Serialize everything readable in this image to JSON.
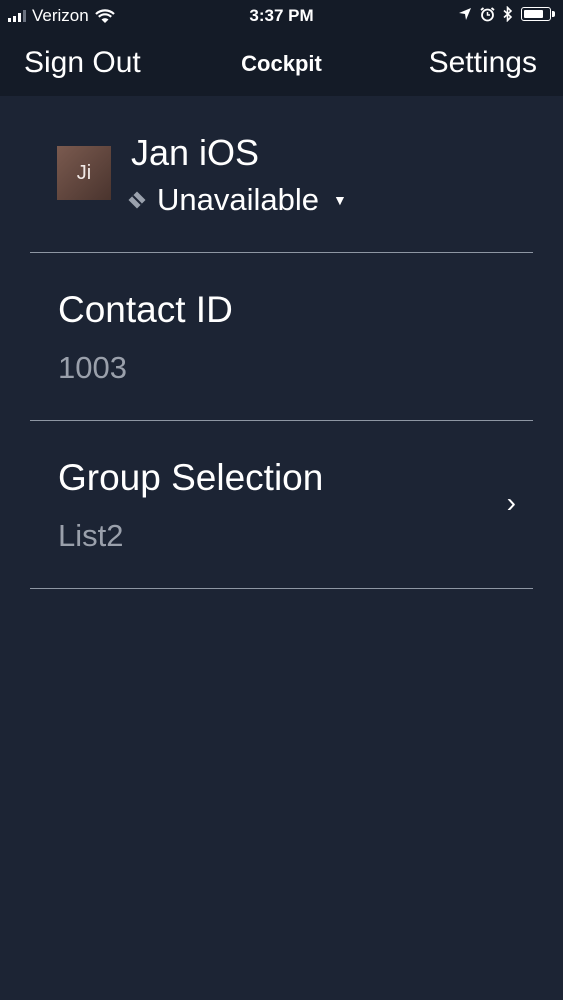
{
  "status_bar": {
    "carrier": "Verizon",
    "time": "3:37 PM",
    "icons": [
      "signal-icon",
      "wifi-icon",
      "location-arrow-icon",
      "alarm-icon",
      "bluetooth-icon",
      "battery-icon"
    ]
  },
  "nav": {
    "left_label": "Sign Out",
    "title": "Cockpit",
    "right_label": "Settings"
  },
  "profile": {
    "avatar_initials": "Ji",
    "name": "Jan iOS",
    "presence": "Unavailable"
  },
  "rows": [
    {
      "label": "Contact ID",
      "value": "1003"
    },
    {
      "label": "Group Selection",
      "value": "List2",
      "chevron": "›"
    }
  ],
  "colors": {
    "background": "#1c2434",
    "top_bar": "#141b27",
    "secondary_text": "#9aa0ab",
    "divider": "#8e96a3"
  }
}
